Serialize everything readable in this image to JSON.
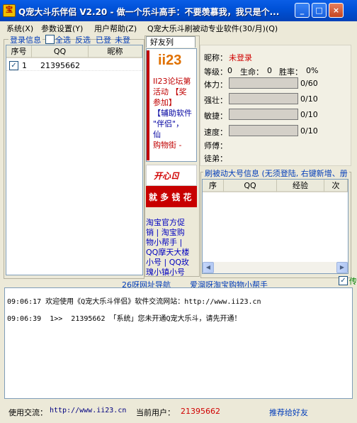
{
  "window": {
    "title": "Q宠大斗乐伴侣 V2.20 - 做一个乐斗高手：不要羡慕我，我只是个...",
    "icon_text": "宝",
    "minimize": "_",
    "maximize": "□",
    "close": "×"
  },
  "menu": [
    "系统(X)",
    "参数设置(Y)",
    "用户帮助(Z)",
    "Q宠大乐斗刷被动专业软件(30/月)(Q)"
  ],
  "login": {
    "label": "登录信息",
    "select_all": "全选",
    "invert": "反选",
    "logged": "已登",
    "not_logged": "未登",
    "columns": [
      "序号",
      "QQ",
      "昵称"
    ],
    "rows": [
      {
        "checked": true,
        "index": "1",
        "qq": "21395662",
        "nick": ""
      }
    ]
  },
  "friends": {
    "label": "好友列",
    "ad_logo": "ii23",
    "ad_lines": [
      "II23论坛第",
      "活动 【奖",
      "参加】",
      "【辅助软件",
      "\"伴侣\"，",
      "仙",
      "购物街 -"
    ],
    "banner1": "开心ㄖ",
    "banner2": "就 多 钱 花",
    "links": [
      "淘宝官方促",
      "销 | 淘宝购",
      "物小帮手 |",
      "QQ摩天大楼",
      "小号 | QQ玫",
      "瑰小镇小号"
    ]
  },
  "profile": {
    "nick_label": "昵称：",
    "nick_value": "未登录",
    "level_label": "等级：",
    "level_value": "0",
    "life_label": "生命：",
    "life_value": "0",
    "winrate_label": "胜率：",
    "winrate_value": "0%",
    "stats": [
      {
        "label": "体力：",
        "value": "0/60"
      },
      {
        "label": "强壮：",
        "value": "0/10"
      },
      {
        "label": "敏捷：",
        "value": "0/10"
      },
      {
        "label": "速度：",
        "value": "0/10"
      }
    ],
    "master_label": "师傅：",
    "apprentice_label": "徒弟："
  },
  "brush": {
    "label": "刷被动大号信息 (无须登陆, 右键新增、册",
    "columns": [
      "序",
      "QQ",
      "经验",
      "次"
    ],
    "checkbox_label": "传"
  },
  "nav": {
    "link1": "26呀网址导航",
    "link2": "爱溜呀淘宝购物小帮手"
  },
  "log": [
    "09:06:17 欢迎使用《Q宠大乐斗伴侣》软件交流网站：http://www.ii23.cn",
    "09:06:39  1>>  21395662 「系统」您未开通Q宠大乐斗，请先开通！"
  ],
  "status": {
    "exchange_label": "使用交流：",
    "exchange_url": "http://www.ii23.cn",
    "user_label": "当前用户：",
    "user_value": "21395662",
    "recommend": "推荐给好友"
  }
}
